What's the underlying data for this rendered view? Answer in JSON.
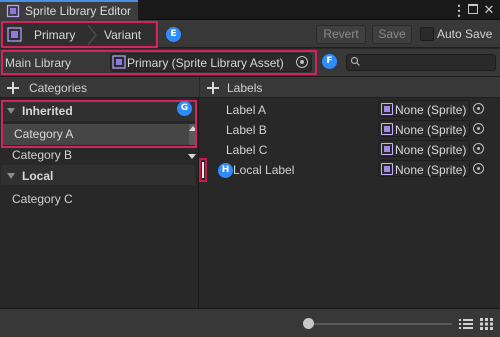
{
  "window": {
    "title": "Sprite Library Editor"
  },
  "toolbar": {
    "breadcrumb": [
      "Primary",
      "Variant"
    ],
    "revert_label": "Revert",
    "save_label": "Save",
    "autosave_label": "Auto Save",
    "autosave_checked": false
  },
  "main_library": {
    "label": "Main Library",
    "value": "Primary (Sprite Library Asset)",
    "search_placeholder": ""
  },
  "categories": {
    "header": "Categories",
    "groups": [
      {
        "label": "Inherited",
        "expanded": true,
        "items": [
          "Category A",
          "Category B"
        ]
      },
      {
        "label": "Local",
        "expanded": true,
        "items": [
          "Category C"
        ]
      }
    ],
    "selected": "Category A"
  },
  "labels": {
    "header": "Labels",
    "rows": [
      {
        "label": "Label A",
        "value": "None (Sprite)"
      },
      {
        "label": "Label B",
        "value": "None (Sprite)"
      },
      {
        "label": "Label C",
        "value": "None (Sprite)"
      },
      {
        "label": "Local Label",
        "value": "None (Sprite)"
      }
    ]
  },
  "annotations": [
    "E",
    "F",
    "G",
    "H"
  ],
  "zoom_level": 0.0,
  "colors": {
    "accent_tab": "#4a90e2",
    "annotation_box": "#d6225e",
    "annotation_badge": "#2e8cff",
    "asset_icon": "#a08be0"
  }
}
